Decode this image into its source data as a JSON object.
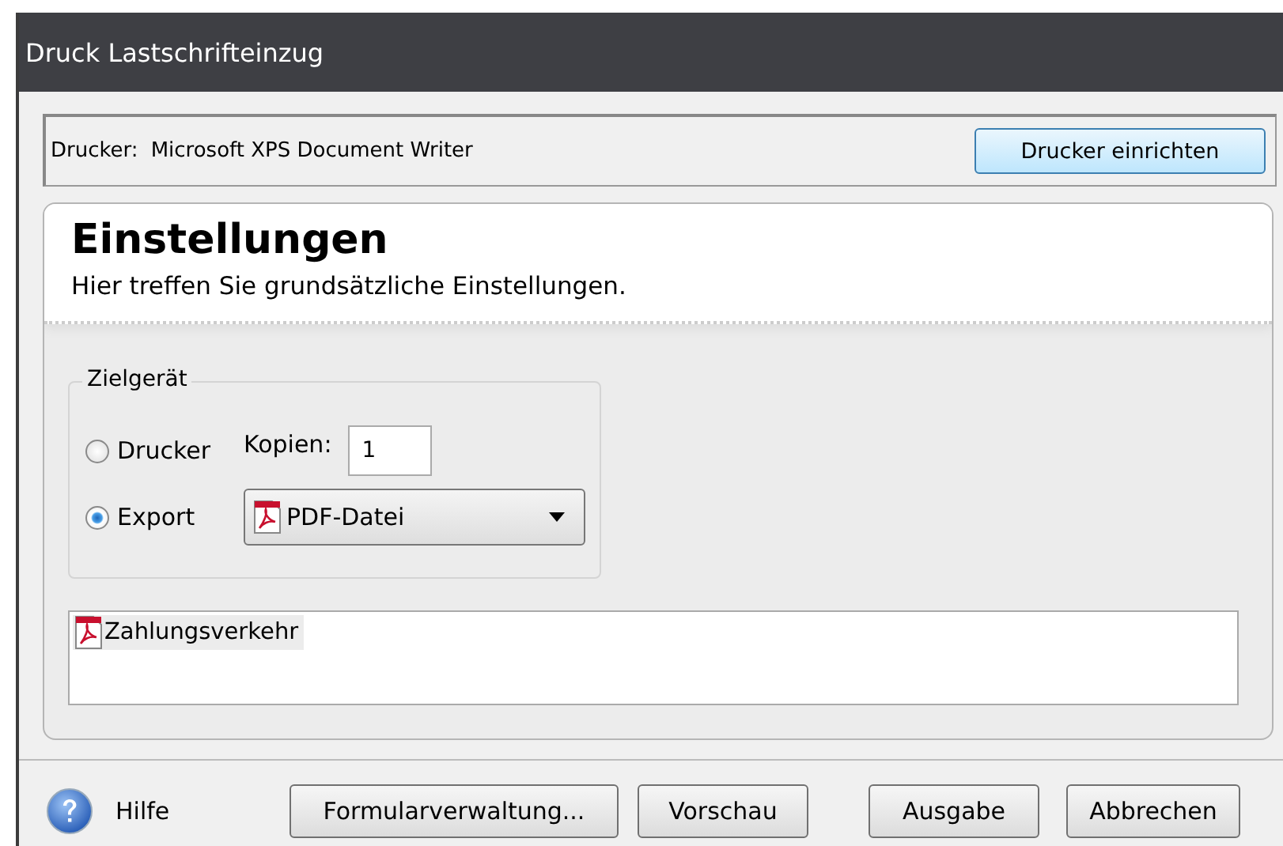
{
  "window": {
    "title": "Druck Lastschrifteinzug"
  },
  "printer": {
    "label": "Drucker:",
    "name": "Microsoft XPS Document Writer",
    "button": "Drucker einrichten"
  },
  "header": {
    "title": "Einstellungen",
    "subtitle": "Hier treffen Sie grundsätzliche Einstellungen."
  },
  "target": {
    "legend": "Zielgerät",
    "options": [
      {
        "label": "Drucker",
        "selected": false
      },
      {
        "label": "Export",
        "selected": true
      }
    ],
    "copies_label": "Kopien:",
    "copies": "1",
    "format": "PDF-Datei"
  },
  "files": [
    {
      "label": "Zahlungsverkehr",
      "selected": true
    }
  ],
  "footer": {
    "help": "Hilfe",
    "buttons": [
      "Formularverwaltung...",
      "Vorschau",
      "Ausgabe",
      "Abbrechen"
    ]
  }
}
